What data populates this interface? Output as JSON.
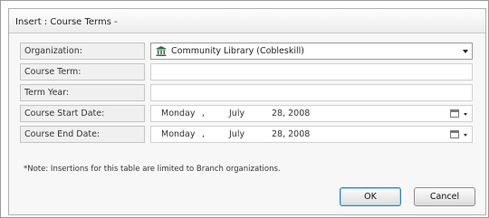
{
  "window": {
    "title": "Insert : Course Terms -"
  },
  "form": {
    "organization": {
      "label": "Organization:",
      "value": "Community Library (Cobleskill)",
      "icon": "library-building-icon"
    },
    "course_term": {
      "label": "Course Term:",
      "value": ""
    },
    "term_year": {
      "label": "Term Year:",
      "value": ""
    },
    "start_date": {
      "label": "Course Start Date:",
      "weekday": "Monday",
      "month": "July",
      "day_year": "28, 2008"
    },
    "end_date": {
      "label": "Course End Date:",
      "weekday": "Monday",
      "month": "July",
      "day_year": "28, 2008"
    }
  },
  "note": "*Note: Insertions for this table are limited to Branch organizations.",
  "buttons": {
    "ok": "OK",
    "cancel": "Cancel"
  }
}
